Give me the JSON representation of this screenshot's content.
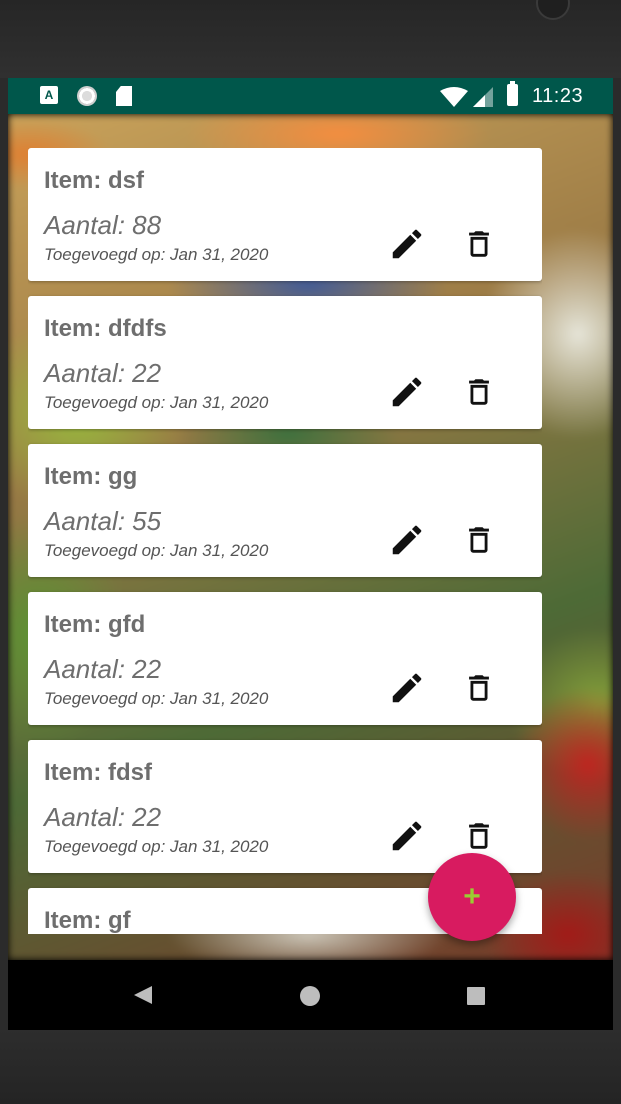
{
  "status_bar": {
    "time": "11:23",
    "icons": [
      "a-icon",
      "sync-icon",
      "sd-card-icon",
      "wifi-icon",
      "signal-icon",
      "battery-icon"
    ]
  },
  "items": [
    {
      "title": "Item: dsf",
      "quantity": "Aantal: 88",
      "date": "Toegevoegd op: Jan 31, 2020"
    },
    {
      "title": "Item: dfdfs",
      "quantity": "Aantal: 22",
      "date": "Toegevoegd op: Jan 31, 2020"
    },
    {
      "title": "Item: gg",
      "quantity": "Aantal: 55",
      "date": "Toegevoegd op: Jan 31, 2020"
    },
    {
      "title": "Item: gfd",
      "quantity": "Aantal: 22",
      "date": "Toegevoegd op: Jan 31, 2020"
    },
    {
      "title": "Item: fdsf",
      "quantity": "Aantal: 22",
      "date": "Toegevoegd op: Jan 31, 2020"
    },
    {
      "title": "Item: gf",
      "quantity": "",
      "date": ""
    }
  ],
  "fab": {
    "label": "+",
    "icon": "plus-icon"
  },
  "navigation": {
    "icons": [
      "back-icon",
      "home-icon",
      "recents-icon"
    ]
  },
  "colors": {
    "status_bar": "#00574b",
    "fab": "#d81b60",
    "fab_icon": "#9acd32",
    "card_text": "#6e6e6e"
  }
}
